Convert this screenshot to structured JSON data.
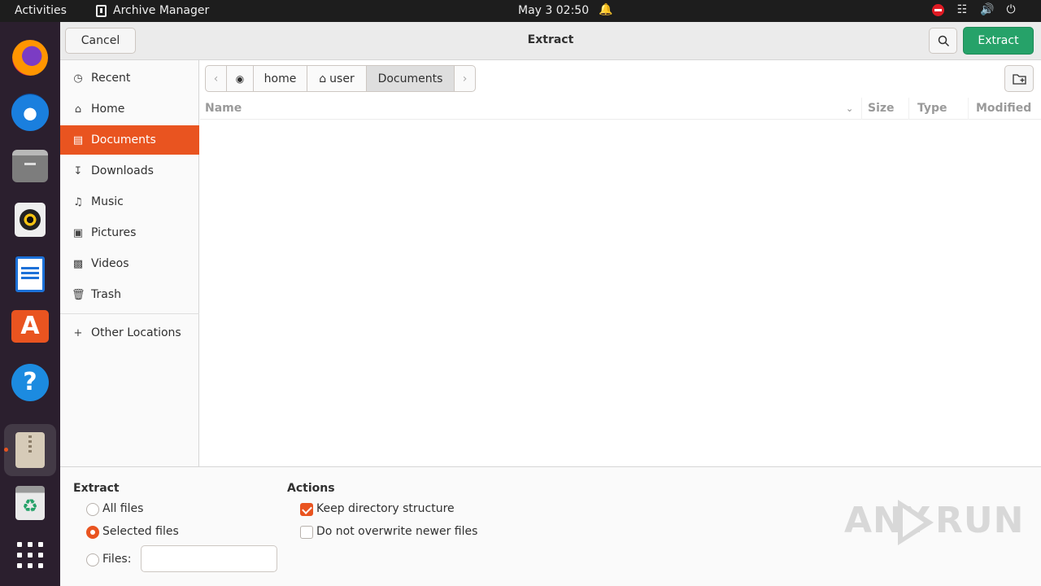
{
  "topbar": {
    "activities": "Activities",
    "app_name": "Archive Manager",
    "clock": "May 3  02:50"
  },
  "dialog": {
    "title": "Extract",
    "cancel_label": "Cancel",
    "extract_label": "Extract"
  },
  "sidebar": {
    "items": [
      {
        "label": "Recent",
        "icon": "clock-icon"
      },
      {
        "label": "Home",
        "icon": "home-icon"
      },
      {
        "label": "Documents",
        "icon": "document-icon"
      },
      {
        "label": "Downloads",
        "icon": "download-icon"
      },
      {
        "label": "Music",
        "icon": "music-icon"
      },
      {
        "label": "Pictures",
        "icon": "picture-icon"
      },
      {
        "label": "Videos",
        "icon": "video-icon"
      },
      {
        "label": "Trash",
        "icon": "trash-icon"
      }
    ],
    "other_locations": "Other Locations"
  },
  "pathbar": {
    "segments": [
      "home",
      "user",
      "Documents"
    ]
  },
  "filelist": {
    "columns": [
      "Name",
      "Size",
      "Type",
      "Modified"
    ]
  },
  "options": {
    "extract_heading": "Extract",
    "all_files": "All files",
    "selected_files": "Selected files",
    "files": "Files:",
    "files_value": "",
    "actions_heading": "Actions",
    "keep_structure": "Keep directory structure",
    "no_overwrite": "Do not overwrite newer files"
  },
  "watermark": {
    "left": "ANY",
    "right": "RUN"
  },
  "colors": {
    "accent": "#e95420",
    "extract_button": "#26a269"
  }
}
